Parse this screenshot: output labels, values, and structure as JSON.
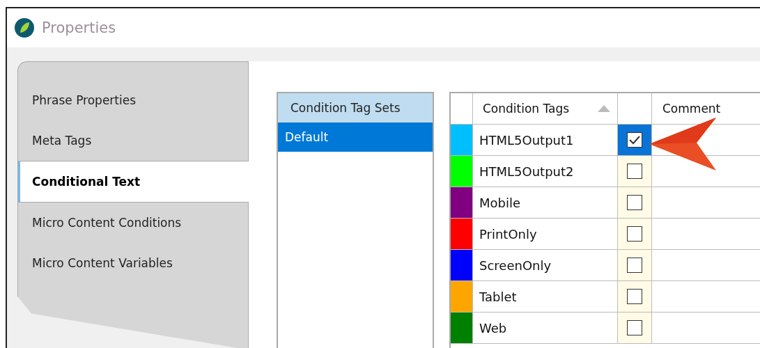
{
  "window": {
    "title": "Properties"
  },
  "tabs": [
    {
      "label": "Phrase Properties",
      "selected": false
    },
    {
      "label": "Meta Tags",
      "selected": false
    },
    {
      "label": "Conditional Text",
      "selected": true
    },
    {
      "label": "Micro Content Conditions",
      "selected": false
    },
    {
      "label": "Micro Content Variables",
      "selected": false
    }
  ],
  "tag_sets": {
    "header": "Condition Tag Sets",
    "items": [
      {
        "label": "Default",
        "selected": true
      }
    ]
  },
  "grid": {
    "columns": [
      "Condition Tags",
      "Comment"
    ],
    "rows": [
      {
        "name": "HTML5Output1",
        "color": "#00bfff",
        "checked": true,
        "selected": true
      },
      {
        "name": "HTML5Output2",
        "color": "#00ff00",
        "checked": false,
        "selected": false
      },
      {
        "name": "Mobile",
        "color": "#800080",
        "checked": false,
        "selected": false
      },
      {
        "name": "PrintOnly",
        "color": "#ff0000",
        "checked": false,
        "selected": false
      },
      {
        "name": "ScreenOnly",
        "color": "#0000ff",
        "checked": false,
        "selected": false
      },
      {
        "name": "Tablet",
        "color": "#ffa500",
        "checked": false,
        "selected": false
      },
      {
        "name": "Web",
        "color": "#008000",
        "checked": false,
        "selected": false
      }
    ]
  }
}
